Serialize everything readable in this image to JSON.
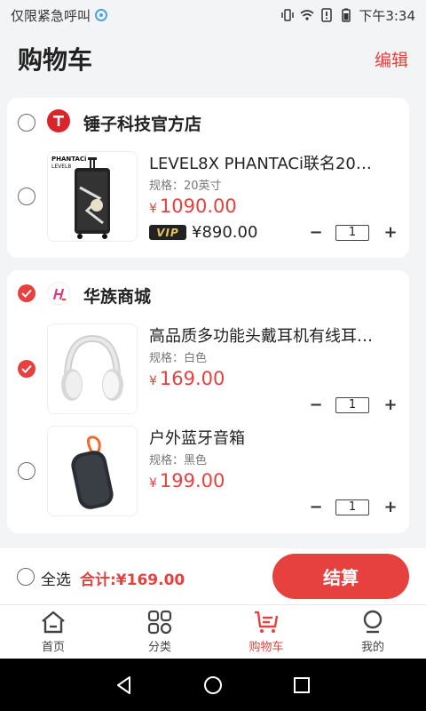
{
  "status_bar": {
    "carrier": "仅限紧急呼叫",
    "time": "下午3:34"
  },
  "header": {
    "title": "购物车",
    "edit_label": "编辑"
  },
  "shops": [
    {
      "name": "锤子科技官方店",
      "logo_letter": "T",
      "checked": false,
      "items": [
        {
          "title": "LEVEL8X PHANTACi联名20…",
          "spec": "规格：20英寸",
          "yen": "¥",
          "price": "1090.00",
          "vip_badge": "VIP",
          "vip_price": "¥890.00",
          "quantity": "1",
          "image": "luggage",
          "checked": false
        }
      ]
    },
    {
      "name": "华族商城",
      "logo_letter": "H",
      "checked": true,
      "items": [
        {
          "title": "高品质多功能头戴耳机有线耳…",
          "spec": "规格：白色",
          "yen": "¥",
          "price": "169.00",
          "quantity": "1",
          "image": "headphones",
          "checked": true
        },
        {
          "title": "户外蓝牙音箱",
          "spec": "规格：黑色",
          "yen": "¥",
          "price": "199.00",
          "quantity": "1",
          "image": "speaker",
          "checked": false
        }
      ]
    }
  ],
  "bottom_bar": {
    "select_all_label": "全选",
    "total_label": "合计:¥169.00",
    "checkout_label": "结算"
  },
  "tabs": [
    {
      "label": "首页",
      "icon": "home-icon",
      "active": false
    },
    {
      "label": "分类",
      "icon": "category-icon",
      "active": false
    },
    {
      "label": "购物车",
      "icon": "cart-icon",
      "active": true
    },
    {
      "label": "我的",
      "icon": "profile-icon",
      "active": false
    }
  ],
  "colors": {
    "accent": "#e6403f",
    "background": "#f3f4f6",
    "card": "#ffffff"
  }
}
